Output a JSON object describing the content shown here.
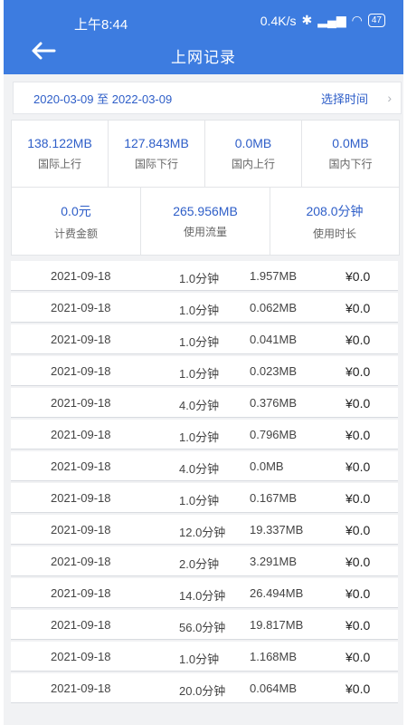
{
  "status_bar": {
    "time": "上午8:44",
    "net_speed": "0.4K/s",
    "signal": "HD ⁴ᴳ",
    "battery": "47"
  },
  "header": {
    "title": "上网记录"
  },
  "date_filter": {
    "range": "2020-03-09 至 2022-03-09",
    "select_label": "选择时间"
  },
  "stats": {
    "row1": [
      {
        "value": "138.122MB",
        "label": "国际上行"
      },
      {
        "value": "127.843MB",
        "label": "国际下行"
      },
      {
        "value": "0.0MB",
        "label": "国内上行"
      },
      {
        "value": "0.0MB",
        "label": "国内下行"
      }
    ],
    "row2": [
      {
        "value": "0.0元",
        "label": "计费金额"
      },
      {
        "value": "265.956MB",
        "label": "使用流量"
      },
      {
        "value": "208.0分钟",
        "label": "使用时长"
      }
    ]
  },
  "records": [
    {
      "date": "2021-09-18",
      "duration": "1.0分钟",
      "size": "1.957MB",
      "fee": "¥0.0"
    },
    {
      "date": "2021-09-18",
      "duration": "1.0分钟",
      "size": "0.062MB",
      "fee": "¥0.0"
    },
    {
      "date": "2021-09-18",
      "duration": "1.0分钟",
      "size": "0.041MB",
      "fee": "¥0.0"
    },
    {
      "date": "2021-09-18",
      "duration": "1.0分钟",
      "size": "0.023MB",
      "fee": "¥0.0"
    },
    {
      "date": "2021-09-18",
      "duration": "4.0分钟",
      "size": "0.376MB",
      "fee": "¥0.0"
    },
    {
      "date": "2021-09-18",
      "duration": "1.0分钟",
      "size": "0.796MB",
      "fee": "¥0.0"
    },
    {
      "date": "2021-09-18",
      "duration": "4.0分钟",
      "size": "0.0MB",
      "fee": "¥0.0"
    },
    {
      "date": "2021-09-18",
      "duration": "1.0分钟",
      "size": "0.167MB",
      "fee": "¥0.0"
    },
    {
      "date": "2021-09-18",
      "duration": "12.0分钟",
      "size": "19.337MB",
      "fee": "¥0.0"
    },
    {
      "date": "2021-09-18",
      "duration": "2.0分钟",
      "size": "3.291MB",
      "fee": "¥0.0"
    },
    {
      "date": "2021-09-18",
      "duration": "14.0分钟",
      "size": "26.494MB",
      "fee": "¥0.0"
    },
    {
      "date": "2021-09-18",
      "duration": "56.0分钟",
      "size": "19.817MB",
      "fee": "¥0.0"
    },
    {
      "date": "2021-09-18",
      "duration": "1.0分钟",
      "size": "1.168MB",
      "fee": "¥0.0"
    },
    {
      "date": "2021-09-18",
      "duration": "20.0分钟",
      "size": "0.064MB",
      "fee": "¥0.0"
    }
  ],
  "colors": {
    "header_bg": "#3d7ce0",
    "accent_text": "#2e5ec8",
    "page_bg": "#f1f2f4"
  }
}
